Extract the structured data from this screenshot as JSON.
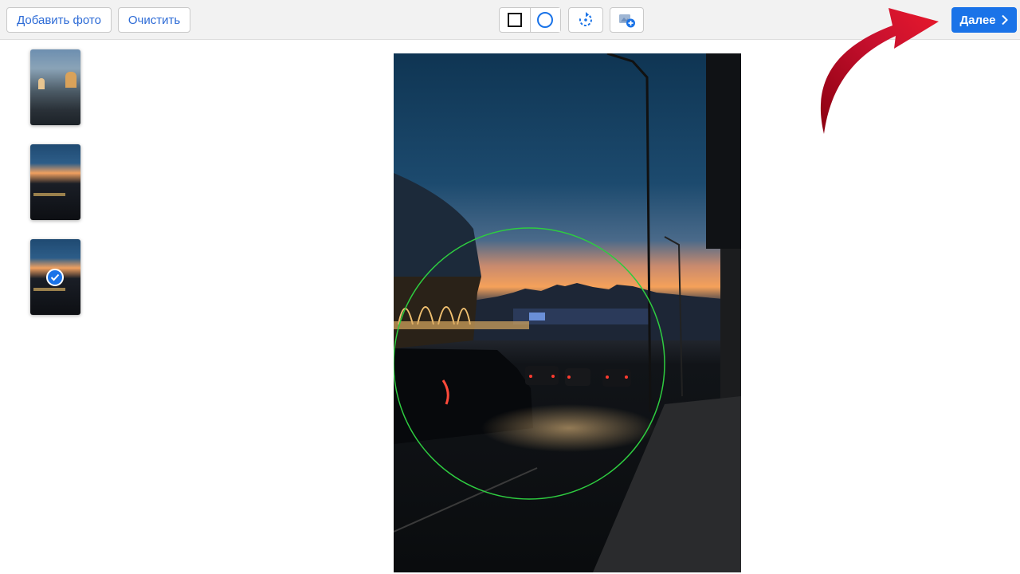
{
  "toolbar": {
    "add_photo_label": "Добавить фото",
    "clear_label": "Очистить",
    "next_label": "Далее"
  },
  "icons": {
    "square": "square-shape-icon",
    "circle": "circle-shape-icon",
    "rotate": "rotate-icon",
    "add_crop": "add-crop-icon",
    "next": "chevron-right-icon",
    "check": "checkmark-icon",
    "annotation": "red-curved-arrow"
  },
  "thumbnails": [
    {
      "selected": false
    },
    {
      "selected": false
    },
    {
      "selected": true
    }
  ],
  "crop": {
    "shape": "circle"
  },
  "colors": {
    "accent": "#1a73e8",
    "crop_outline": "#2ecc40",
    "annotation_arrow": "#c8102e"
  }
}
